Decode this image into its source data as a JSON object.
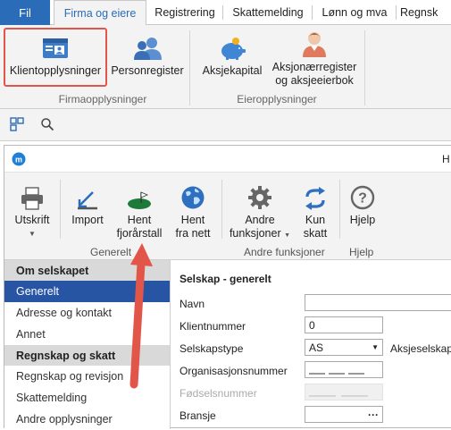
{
  "tabs": [
    {
      "label": "Fil"
    },
    {
      "label": "Firma og eiere"
    },
    {
      "label": "Registrering"
    },
    {
      "label": "Skattemelding"
    },
    {
      "label": "Lønn og mva"
    },
    {
      "label": "Regnsk"
    }
  ],
  "ribbon": {
    "buttons": {
      "klient": "Klientopplysninger",
      "person": "Personregister",
      "aksjekapital": "Aksjekapital",
      "aksjonaer_1": "Aksjonærregister",
      "aksjonaer_2": "og aksjeeierbok"
    },
    "groups": {
      "firma": "Firmaopplysninger",
      "eier": "Eieropplysninger"
    }
  },
  "inner": {
    "title_fragment": "H",
    "buttons": {
      "utskrift": "Utskrift",
      "import": "Import",
      "hent1_1": "Hent",
      "hent1_2": "fjorårstall",
      "hent2_1": "Hent",
      "hent2_2": "fra nett",
      "andre_1": "Andre",
      "andre_2": "funksjoner",
      "kun_1": "Kun",
      "kun_2": "skatt",
      "hjelp": "Hjelp"
    },
    "groups": {
      "generelt": "Generelt",
      "andre": "Andre funksjoner",
      "hjelp": "Hjelp"
    }
  },
  "sidebar": {
    "head1": "Om selskapet",
    "items1": [
      "Generelt",
      "Adresse og kontakt",
      "Annet"
    ],
    "head2": "Regnskap og skatt",
    "items2": [
      "Regnskap og revisjon",
      "Skattemelding",
      "Andre opplysninger"
    ]
  },
  "form": {
    "section_title": "Selskap - generelt",
    "labels": {
      "navn": "Navn",
      "klientnummer": "Klientnummer",
      "selskapstype": "Selskapstype",
      "orgnr": "Organisasjonsnummer",
      "fodselsnummer": "Fødselsnummer",
      "bransje": "Bransje"
    },
    "values": {
      "navn": "",
      "klientnummer": "0",
      "selskapstype": "AS",
      "selskapstype_desc": "Aksjeselskap",
      "bransje_btn": "···"
    }
  },
  "colors": {
    "accent": "#2b6cb8",
    "highlight": "#e2564a",
    "arrow": "#e2564a",
    "active_nav": "#2855a3"
  }
}
